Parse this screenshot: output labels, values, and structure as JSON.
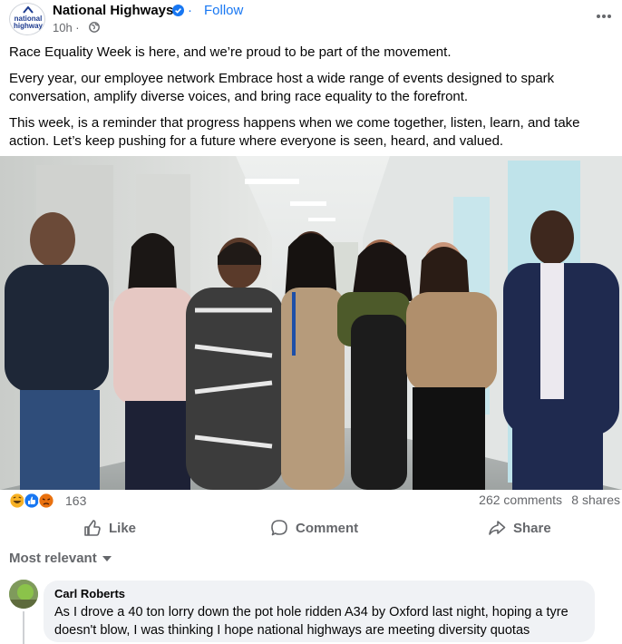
{
  "post": {
    "page_name": "National Highways",
    "follow_label": "Follow",
    "time": "10h ·",
    "avatar_text": "national highways",
    "paragraphs": [
      "Race Equality Week is here, and we’re proud to be part of the movement.",
      "Every year, our employee network Embrace host a wide range of events designed to spark conversation, amplify diverse voices, and bring race equality to the forefront.",
      "This week, is a reminder that progress happens when we come together, listen, learn, and take action. Let’s keep pushing for a future where everyone is seen, heard, and valued."
    ]
  },
  "stats": {
    "reaction_count": "163",
    "reaction_icons": [
      "haha-icon",
      "like-icon",
      "angry-icon"
    ],
    "comments": "262 comments",
    "shares": "8 shares"
  },
  "actions": {
    "like": "Like",
    "comment": "Comment",
    "share": "Share"
  },
  "comments_sort": "Most relevant",
  "comment": {
    "author": "Carl Roberts",
    "text": "As I drove a 40 ton lorry down the pot hole ridden A34 by Oxford last night, hoping a tyre doesn't blow, I was thinking I hope national highways are meeting diversity quotas"
  },
  "colors": {
    "accent": "#1877f2",
    "muted": "#65676b",
    "bubble": "#f0f2f5"
  }
}
